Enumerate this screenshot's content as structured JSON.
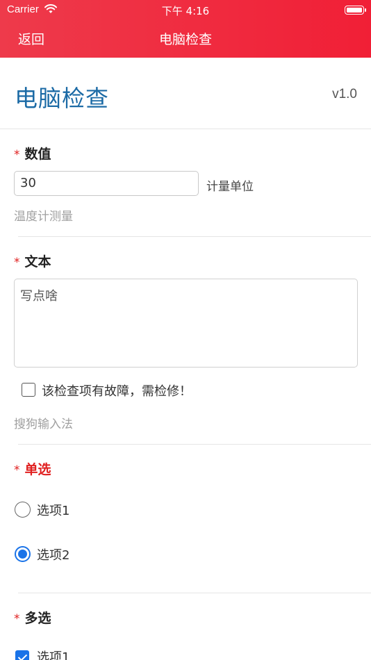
{
  "status_bar": {
    "carrier": "Carrier",
    "time": "下午 4:16"
  },
  "nav": {
    "back_label": "返回",
    "title": "电脑检查"
  },
  "header": {
    "title": "电脑检查",
    "version": "v1.0"
  },
  "required_mark": "*",
  "numeric_field": {
    "label": "数值",
    "value": "30",
    "unit": "计量单位",
    "hint": "温度计测量"
  },
  "text_field": {
    "label": "文本",
    "value": "写点啥",
    "fault_checkbox_label": "该检查项有故障，需检修！",
    "fault_checked": false,
    "hint": "搜狗输入法"
  },
  "single_choice": {
    "label": "单选",
    "label_color": "#e02020",
    "options": [
      {
        "label": "选项1",
        "selected": false
      },
      {
        "label": "选项2",
        "selected": true
      }
    ]
  },
  "multi_choice": {
    "label": "多选",
    "options": [
      {
        "label": "选项1",
        "checked": true
      }
    ]
  },
  "colors": {
    "topbar": "#f11f36",
    "title": "#1b6aa5",
    "accent": "#1a73e8",
    "required": "#e02020"
  }
}
